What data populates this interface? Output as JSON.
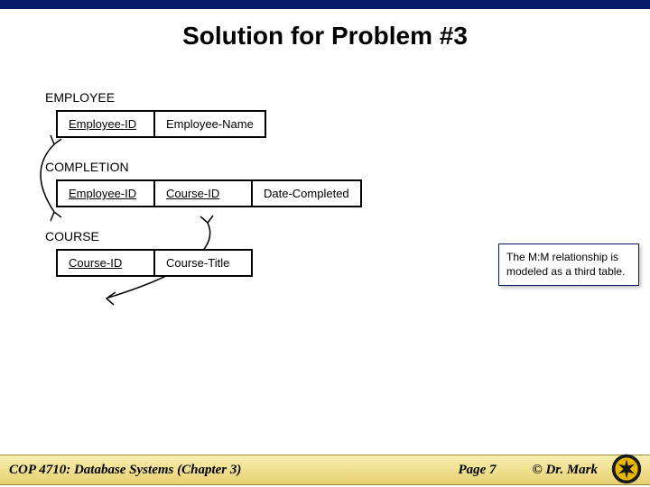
{
  "title": "Solution for Problem #3",
  "tables": {
    "employee": {
      "label": "EMPLOYEE",
      "cols": [
        "Employee-ID",
        "Employee-Name"
      ]
    },
    "completion": {
      "label": "COMPLETION",
      "cols": [
        "Employee-ID",
        "Course-ID",
        "Date-Completed"
      ]
    },
    "course": {
      "label": "COURSE",
      "cols": [
        "Course-ID",
        "Course-Title"
      ]
    }
  },
  "note": "The M:M relationship is modeled as a third table.",
  "footer": {
    "course": "COP 4710: Database Systems  (Chapter 3)",
    "page": "Page 7",
    "copyright": "© Dr. Mark"
  }
}
